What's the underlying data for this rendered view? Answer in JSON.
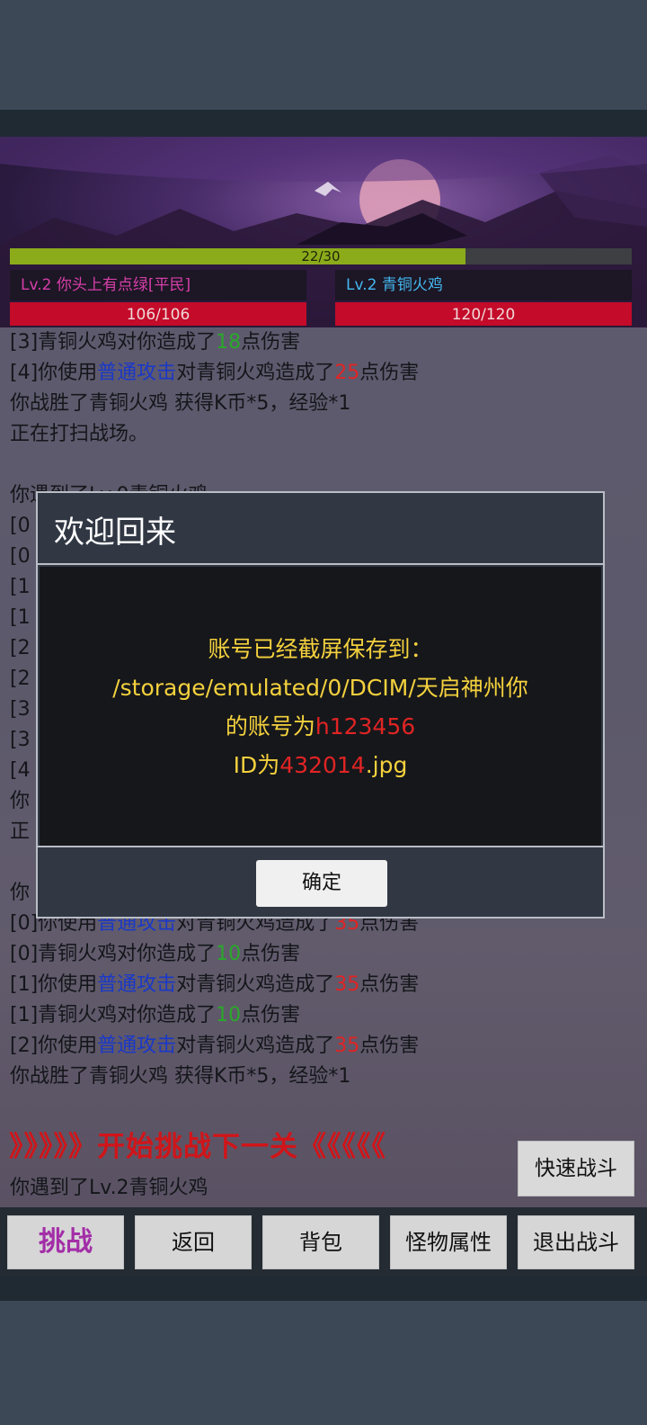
{
  "status": {
    "xp_text": "22/30",
    "xp_fraction": 0.733,
    "player_name": "Lv.2 你头上有点绿[平民]",
    "enemy_name": "Lv.2 青铜火鸡",
    "player_hp": "106/106",
    "enemy_hp": "120/120"
  },
  "log": {
    "lines": [
      {
        "parts": [
          {
            "t": "[3]青铜火鸡对你造成了"
          },
          {
            "t": "18",
            "c": "green"
          },
          {
            "t": "点伤害"
          }
        ]
      },
      {
        "parts": [
          {
            "t": "[4]你使用"
          },
          {
            "t": "普通攻击",
            "c": "blue"
          },
          {
            "t": "对青铜火鸡造成了"
          },
          {
            "t": "25",
            "c": "red"
          },
          {
            "t": "点伤害"
          }
        ]
      },
      {
        "parts": [
          {
            "t": "你战胜了青铜火鸡 获得K币*5，经验*1"
          }
        ]
      },
      {
        "parts": [
          {
            "t": "正在打扫战场。"
          }
        ]
      },
      {
        "parts": [
          {
            "t": ""
          }
        ]
      },
      {
        "parts": [
          {
            "t": "你遇到了Lv.0青铜火鸡"
          }
        ]
      },
      {
        "parts": [
          {
            "t": "[0"
          }
        ]
      },
      {
        "parts": [
          {
            "t": "[0"
          }
        ]
      },
      {
        "parts": [
          {
            "t": "[1"
          }
        ]
      },
      {
        "parts": [
          {
            "t": "[1"
          }
        ]
      },
      {
        "parts": [
          {
            "t": "[2"
          }
        ]
      },
      {
        "parts": [
          {
            "t": "[2"
          }
        ]
      },
      {
        "parts": [
          {
            "t": "[3"
          }
        ]
      },
      {
        "parts": [
          {
            "t": "[3"
          }
        ]
      },
      {
        "parts": [
          {
            "t": "[4"
          }
        ]
      },
      {
        "parts": [
          {
            "t": "你"
          }
        ]
      },
      {
        "parts": [
          {
            "t": "正"
          }
        ]
      },
      {
        "parts": [
          {
            "t": ""
          }
        ]
      },
      {
        "parts": [
          {
            "t": "你"
          }
        ]
      },
      {
        "parts": [
          {
            "t": "[0]你使用"
          },
          {
            "t": "普通攻击",
            "c": "blue"
          },
          {
            "t": "对青铜火鸡造成了"
          },
          {
            "t": "35",
            "c": "red"
          },
          {
            "t": "点伤害"
          }
        ]
      },
      {
        "parts": [
          {
            "t": "[0]青铜火鸡对你造成了"
          },
          {
            "t": "10",
            "c": "green"
          },
          {
            "t": "点伤害"
          }
        ]
      },
      {
        "parts": [
          {
            "t": "[1]你使用"
          },
          {
            "t": "普通攻击",
            "c": "blue"
          },
          {
            "t": "对青铜火鸡造成了"
          },
          {
            "t": "35",
            "c": "red"
          },
          {
            "t": "点伤害"
          }
        ]
      },
      {
        "parts": [
          {
            "t": "[1]青铜火鸡对你造成了"
          },
          {
            "t": "10",
            "c": "green"
          },
          {
            "t": "点伤害"
          }
        ]
      },
      {
        "parts": [
          {
            "t": "[2]你使用"
          },
          {
            "t": "普通攻击",
            "c": "blue"
          },
          {
            "t": "对青铜火鸡造成了"
          },
          {
            "t": "35",
            "c": "red"
          },
          {
            "t": "点伤害"
          }
        ]
      },
      {
        "parts": [
          {
            "t": "你战胜了青铜火鸡 获得K币*5，经验*1"
          }
        ]
      }
    ],
    "challenge_banner": "》》》》》开始挑战下一关《《《《《",
    "encounter_line": "你遇到了Lv.2青铜火鸡"
  },
  "buttons": {
    "quick_battle": "快速战斗",
    "challenge": "挑战",
    "back": "返回",
    "bag": "背包",
    "monster_attr": "怪物属性",
    "exit_battle": "退出战斗"
  },
  "dialog": {
    "title": "欢迎回来",
    "line1": "账号已经截屏保存到：",
    "line2": "/storage/emulated/0/DCIM/天启神州你",
    "line3_prefix": "的账号为",
    "account": "h123456",
    "line4_prefix": "ID为",
    "id": "432014",
    "line4_suffix": ".jpg",
    "ok": "确定"
  },
  "colors": {
    "accent_red": "#e02424",
    "skill_blue": "#1a38c8",
    "heal_green": "#2aa82a",
    "dialog_text": "#f4d13d",
    "hp_red": "#c40b2a",
    "xp_green": "#8bab1b"
  }
}
